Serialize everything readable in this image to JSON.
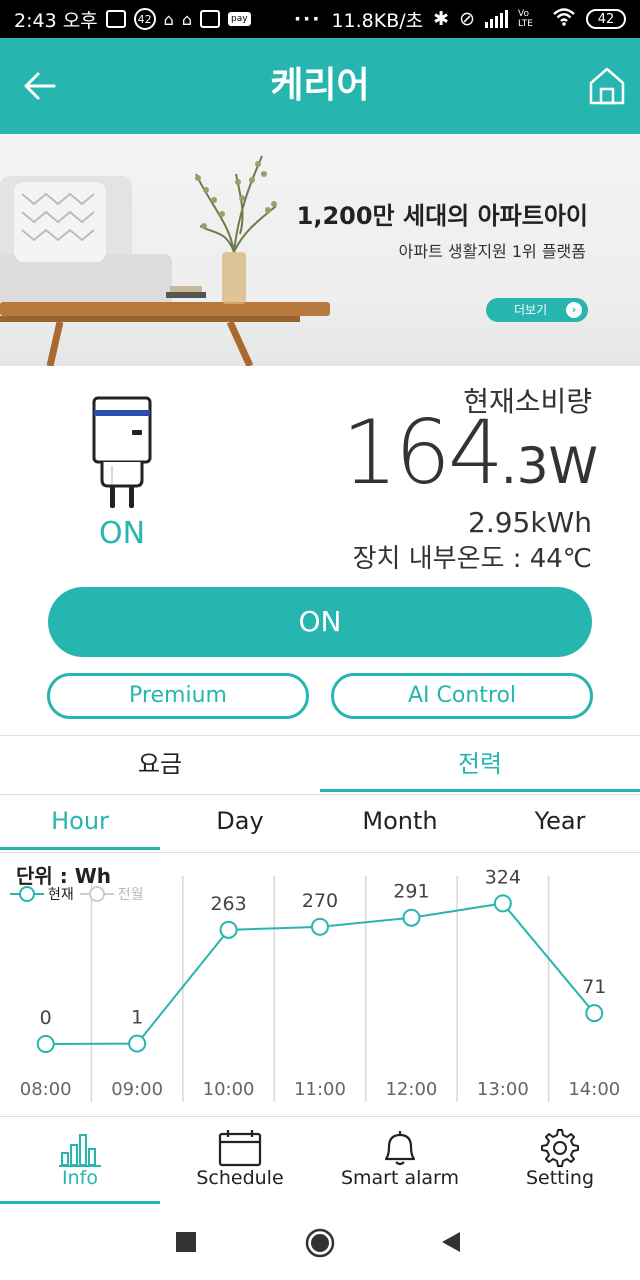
{
  "status_bar": {
    "time": "2:43 오후",
    "notif_count": "42",
    "pay_label": "pay",
    "dots": "···",
    "net_speed": "11.8KB/초",
    "volte": "Vo LTE",
    "battery": "42"
  },
  "header": {
    "title": "케리어",
    "back_icon": "back-arrow-icon",
    "home_icon": "home-icon"
  },
  "banner": {
    "headline": "1,200만 세대의 아파트아이",
    "subline": "아파트 생활지원 1위 플랫폼",
    "more_label": "더보기"
  },
  "device": {
    "state": "ON",
    "current_label": "현재소비량",
    "current_big": "164",
    "current_small": ".3W",
    "energy": "2.95kWh",
    "temperature": "장치 내부온도 : 44℃"
  },
  "buttons": {
    "power": "ON",
    "premium": "Premium",
    "ai_control": "AI Control"
  },
  "main_tabs": [
    {
      "label": "요금",
      "active": false
    },
    {
      "label": "전력",
      "active": true
    }
  ],
  "period_tabs": [
    {
      "label": "Hour",
      "active": true
    },
    {
      "label": "Day",
      "active": false
    },
    {
      "label": "Month",
      "active": false
    },
    {
      "label": "Year",
      "active": false
    }
  ],
  "chart_data": {
    "type": "line",
    "unit_label": "단위 : Wh",
    "x": [
      "08:00",
      "09:00",
      "10:00",
      "11:00",
      "12:00",
      "13:00",
      "14:00"
    ],
    "series": [
      {
        "name": "현재",
        "values": [
          0,
          1,
          263,
          270,
          291,
          324,
          71
        ],
        "color": "#27b5b0"
      },
      {
        "name": "전월",
        "values": [],
        "color": "#cccccc"
      }
    ],
    "data_labels": [
      "0",
      "1",
      "263",
      "270",
      "291",
      "324",
      "71"
    ],
    "grid": true
  },
  "bottom_nav": [
    {
      "label": "Info",
      "icon": "bar-chart-icon",
      "active": true
    },
    {
      "label": "Schedule",
      "icon": "calendar-icon",
      "active": false
    },
    {
      "label": "Smart alarm",
      "icon": "bell-icon",
      "active": false
    },
    {
      "label": "Setting",
      "icon": "gear-icon",
      "active": false
    }
  ],
  "colors": {
    "accent": "#27b5b0",
    "text": "#222222",
    "muted": "#cccccc"
  }
}
